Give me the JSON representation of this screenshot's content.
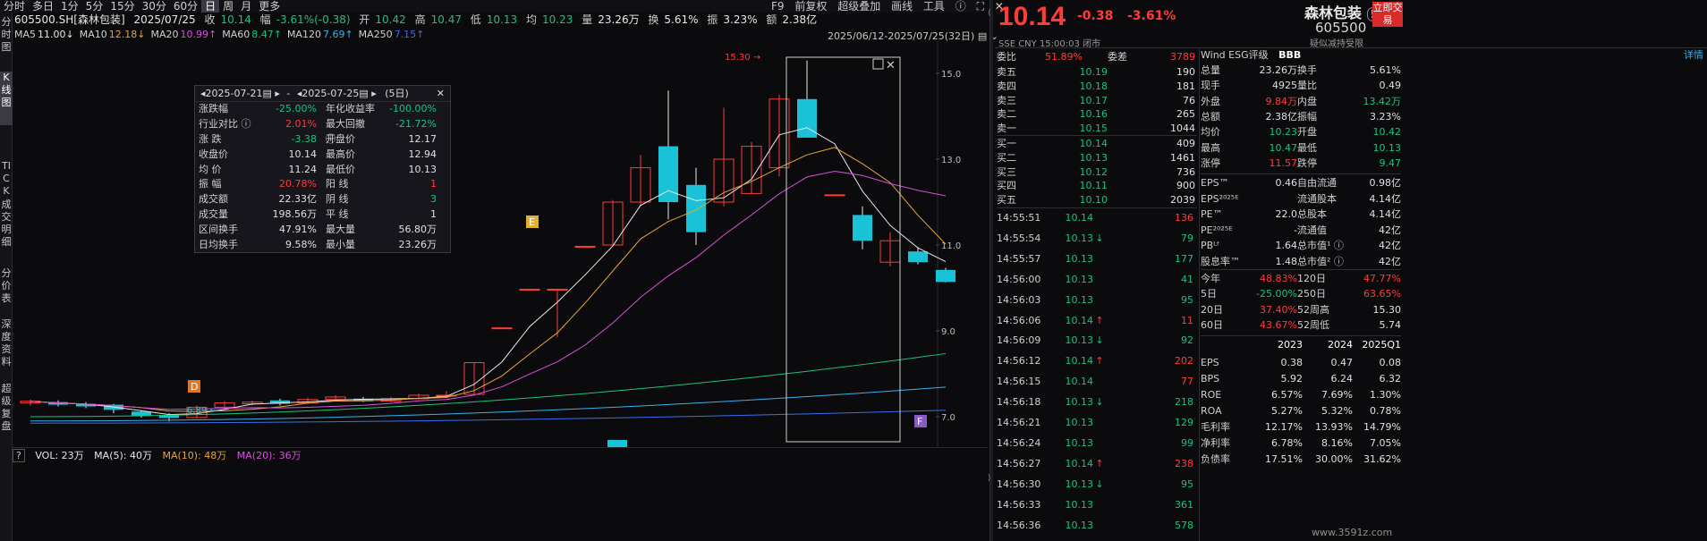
{
  "tabs": [
    "分时",
    "多日",
    "1分",
    "5分",
    "15分",
    "30分",
    "60分",
    "日",
    "周",
    "月",
    "更多"
  ],
  "active_tab": "日",
  "toolbar": {
    "f9": "F9",
    "fuquan": "前复权",
    "overlay": "超级叠加",
    "draw": "画线",
    "tools": "工具"
  },
  "leftbar": [
    {
      "label": "分时图",
      "active": false
    },
    {
      "label": "K线图",
      "active": true
    },
    {
      "label": "TICK",
      "active": false
    },
    {
      "label": "成交明细",
      "active": false
    },
    {
      "label": "分价表",
      "active": false
    },
    {
      "label": "深度资料",
      "active": false
    },
    {
      "label": "超级复盘",
      "active": false
    }
  ],
  "info": {
    "code": "605500.SH[森林包装]",
    "date": "2025/07/25",
    "close_label": "收",
    "close": "10.14",
    "chg_label": "幅",
    "chg": "-3.61%(-0.38)",
    "open_label": "开",
    "open": "10.42",
    "high_label": "高",
    "high": "10.47",
    "low_label": "低",
    "low": "10.13",
    "avg_label": "均",
    "avg": "10.23",
    "vol_label": "量",
    "vol": "23.26万",
    "turn_label": "换",
    "turn": "5.61%",
    "amp_label": "振",
    "amp": "3.23%",
    "amt_label": "额",
    "amt": "2.38亿"
  },
  "ma": [
    {
      "label": "MA5",
      "value": "11.00↓",
      "color": "#e8e8e8"
    },
    {
      "label": "MA10",
      "value": "12.18↓",
      "color": "#e8a43a"
    },
    {
      "label": "MA20",
      "value": "10.99↑",
      "color": "#d94fd9"
    },
    {
      "label": "MA60",
      "value": "8.47↑",
      "color": "#19c37d"
    },
    {
      "label": "MA120",
      "value": "7.69↑",
      "color": "#3ab0e8"
    },
    {
      "label": "MA250",
      "value": "7.15↑",
      "color": "#3a6ee8"
    }
  ],
  "range_text": "2025/06/12-2025/07/25(32日)",
  "y_axis": [
    "15.0",
    "13.0",
    "11.0",
    "9.0",
    "7.0"
  ],
  "annotations": {
    "high_label": "15.30",
    "low_label": "6.89",
    "E": "E",
    "D": "D",
    "F": "F"
  },
  "stats": {
    "date_from": "2025-07-21",
    "date_to": "2025-07-25",
    "days": "(5日)",
    "sep": "-",
    "rows": [
      [
        "涨跌幅",
        "-25.00%",
        "年化收益率",
        "-100.00%"
      ],
      [
        "行业对比 ⓘ",
        "2.01%",
        "最大回撤 ⓘ",
        "-21.72%"
      ],
      [
        "涨  跌",
        "-3.38",
        "开盘价",
        "12.17"
      ],
      [
        "收盘价",
        "10.14",
        "最高价",
        "12.94"
      ],
      [
        "均  价",
        "11.24",
        "最低价",
        "10.13"
      ],
      [
        "振  幅",
        "20.78%",
        "阳  线",
        "1"
      ],
      [
        "成交额",
        "22.33亿",
        "阴  线",
        "3"
      ],
      [
        "成交量",
        "198.56万",
        "平  线",
        "1"
      ],
      [
        "区间换手",
        "47.91%",
        "最大量",
        "56.80万"
      ],
      [
        "日均换手",
        "9.58%",
        "最小量",
        "23.26万"
      ]
    ]
  },
  "volbar": {
    "q": "?",
    "vol": "VOL: 23万",
    "ma5": "MA(5): 40万",
    "ma10": "MA(10): 48万",
    "ma20": "MA(20): 36万"
  },
  "quote": {
    "price": "10.14",
    "chg": "-0.38",
    "pct": "-3.61%",
    "name": "森林包装",
    "code": "605500",
    "buy": "立即交易",
    "sub": "SSE  CNY  15:00:03  闭市",
    "sub2": "疑似减持受限"
  },
  "order_book": {
    "wb_label": "委比",
    "wb": "51.89%",
    "wc_label": "委差",
    "wc": "3789",
    "asks": [
      [
        "卖五",
        "10.19",
        "190"
      ],
      [
        "卖四",
        "10.18",
        "181"
      ],
      [
        "卖三",
        "10.17",
        "76"
      ],
      [
        "卖二",
        "10.16",
        "265"
      ],
      [
        "卖一",
        "10.15",
        "1044"
      ]
    ],
    "bids": [
      [
        "买一",
        "10.14",
        "409"
      ],
      [
        "买二",
        "10.13",
        "1461"
      ],
      [
        "买三",
        "10.12",
        "736"
      ],
      [
        "买四",
        "10.11",
        "900"
      ],
      [
        "买五",
        "10.10",
        "2039"
      ]
    ]
  },
  "ticks": [
    [
      "14:55:51",
      "10.14",
      "",
      "136",
      "r"
    ],
    [
      "14:55:54",
      "10.13",
      "↓",
      "79",
      "g"
    ],
    [
      "14:55:57",
      "10.13",
      "",
      "177",
      "g"
    ],
    [
      "14:56:00",
      "10.13",
      "",
      "41",
      "g"
    ],
    [
      "14:56:03",
      "10.13",
      "",
      "95",
      "g"
    ],
    [
      "14:56:06",
      "10.14",
      "↑",
      "11",
      "r"
    ],
    [
      "14:56:09",
      "10.13",
      "↓",
      "92",
      "g"
    ],
    [
      "14:56:12",
      "10.14",
      "↑",
      "202",
      "r"
    ],
    [
      "14:56:15",
      "10.14",
      "",
      "77",
      "r"
    ],
    [
      "14:56:18",
      "10.13",
      "↓",
      "218",
      "g"
    ],
    [
      "14:56:21",
      "10.13",
      "",
      "129",
      "g"
    ],
    [
      "14:56:24",
      "10.13",
      "",
      "99",
      "g"
    ],
    [
      "14:56:27",
      "10.14",
      "↑",
      "238",
      "r"
    ],
    [
      "14:56:30",
      "10.13",
      "↓",
      "95",
      "g"
    ],
    [
      "14:56:33",
      "10.13",
      "",
      "361",
      "g"
    ],
    [
      "14:56:36",
      "10.13",
      "",
      "578",
      "g"
    ]
  ],
  "wind": {
    "label": "Wind ESG评级",
    "rating": "BBB",
    "detail": "详情"
  },
  "fund_rows": [
    [
      "总量",
      "23.26万",
      "w",
      "换手",
      "5.61%",
      "w"
    ],
    [
      "现手",
      "4925",
      "w",
      "量比",
      "0.49",
      "w"
    ],
    [
      "外盘",
      "9.84万",
      "r",
      "内盘",
      "13.42万",
      "g"
    ],
    [
      "总额",
      "2.38亿",
      "w",
      "振幅",
      "3.23%",
      "w"
    ],
    [
      "均价",
      "10.23",
      "g",
      "开盘",
      "10.42",
      "g"
    ],
    [
      "最高",
      "10.47",
      "g",
      "最低",
      "10.13",
      "g"
    ],
    [
      "涨停",
      "11.57",
      "r",
      "跌停",
      "9.47",
      "g"
    ]
  ],
  "fin_rows": [
    [
      "EPS™",
      "0.46",
      "自由流通",
      "0.98亿"
    ],
    [
      "EPS²⁰²⁵ᴱ",
      "",
      "流通股本",
      "4.14亿"
    ],
    [
      "PE™",
      "22.0",
      "总股本",
      "4.14亿"
    ],
    [
      "PE²⁰²⁵ᴱ",
      "-",
      "流通值",
      "42亿"
    ],
    [
      "PBᴸᶠ",
      "1.64",
      "总市值¹ ⓘ",
      "42亿"
    ],
    [
      "股息率™",
      "1.48",
      "总市值² ⓘ",
      "42亿"
    ]
  ],
  "perf_rows": [
    [
      "今年",
      "48.83%",
      "r",
      "120日",
      "47.77%",
      "r"
    ],
    [
      "5日",
      "-25.00%",
      "g",
      "250日",
      "63.65%",
      "r"
    ],
    [
      "20日",
      "37.40%",
      "r",
      "52周高",
      "15.30",
      "w"
    ],
    [
      "60日",
      "43.67%",
      "r",
      "52周低",
      "5.74",
      "w"
    ]
  ],
  "annual": {
    "years": [
      "2023",
      "2024",
      "2025Q1"
    ],
    "rows": [
      [
        "EPS",
        "0.38",
        "0.47",
        "0.08"
      ],
      [
        "BPS",
        "5.92",
        "6.24",
        "6.32"
      ],
      [
        "ROE",
        "6.57%",
        "7.69%",
        "1.30%"
      ],
      [
        "ROA",
        "5.27%",
        "5.32%",
        "0.78%"
      ],
      [
        "毛利率",
        "12.17%",
        "13.93%",
        "14.79%"
      ],
      [
        "净利率",
        "6.78%",
        "8.16%",
        "7.05%"
      ],
      [
        "负债率",
        "17.51%",
        "30.00%",
        "31.62%"
      ]
    ]
  },
  "watermark": "www.3591z.com",
  "colors": {
    "up": "#ff3b3b",
    "down": "#19c2d6",
    "bg": "#0b0b0e",
    "ma5": "#e8e8e8",
    "ma10": "#e8a43a",
    "ma20": "#d94fd9",
    "ma60": "#19c37d",
    "ma120": "#3ab0e8",
    "ma250": "#3a6ee8"
  },
  "chart_data": {
    "type": "candlestick",
    "y_range": [
      6.5,
      16
    ],
    "candles": [
      {
        "o": 7.32,
        "c": 7.36,
        "h": 7.4,
        "l": 7.26
      },
      {
        "o": 7.34,
        "c": 7.28,
        "h": 7.38,
        "l": 7.24
      },
      {
        "o": 7.3,
        "c": 7.24,
        "h": 7.34,
        "l": 7.2
      },
      {
        "o": 7.28,
        "c": 7.16,
        "h": 7.3,
        "l": 7.08
      },
      {
        "o": 7.12,
        "c": 7.02,
        "h": 7.14,
        "l": 6.98
      },
      {
        "o": 7.04,
        "c": 6.97,
        "h": 7.08,
        "l": 6.89
      },
      {
        "o": 6.98,
        "c": 7.22,
        "h": 7.26,
        "l": 6.96
      },
      {
        "o": 7.22,
        "c": 7.32,
        "h": 7.36,
        "l": 7.18
      },
      {
        "o": 7.3,
        "c": 7.34,
        "h": 7.38,
        "l": 7.26
      },
      {
        "o": 7.38,
        "c": 7.3,
        "h": 7.42,
        "l": 7.26
      },
      {
        "o": 7.32,
        "c": 7.4,
        "h": 7.44,
        "l": 7.3
      },
      {
        "o": 7.4,
        "c": 7.46,
        "h": 7.5,
        "l": 7.36
      },
      {
        "o": 7.42,
        "c": 7.36,
        "h": 7.46,
        "l": 7.34
      },
      {
        "o": 7.36,
        "c": 7.42,
        "h": 7.46,
        "l": 7.34
      },
      {
        "o": 7.42,
        "c": 7.5,
        "h": 7.54,
        "l": 7.4
      },
      {
        "o": 7.48,
        "c": 7.5,
        "h": 7.6,
        "l": 7.44
      },
      {
        "o": 7.52,
        "c": 8.26,
        "h": 8.26,
        "l": 7.52
      },
      {
        "o": 9.07,
        "c": 9.07,
        "h": 9.07,
        "l": 9.07
      },
      {
        "o": 9.97,
        "c": 9.97,
        "h": 9.97,
        "l": 9.97
      },
      {
        "o": 9.97,
        "c": 9.97,
        "h": 9.97,
        "l": 8.86
      },
      {
        "o": 10.97,
        "c": 10.97,
        "h": 10.97,
        "l": 10.97
      },
      {
        "o": 11.0,
        "c": 12.0,
        "h": 12.05,
        "l": 10.97
      },
      {
        "o": 12.0,
        "c": 12.8,
        "h": 13.1,
        "l": 11.9
      },
      {
        "o": 13.3,
        "c": 12.0,
        "h": 14.6,
        "l": 11.6
      },
      {
        "o": 12.4,
        "c": 11.3,
        "h": 12.8,
        "l": 11.0
      },
      {
        "o": 12.0,
        "c": 13.0,
        "h": 14.2,
        "l": 11.9
      },
      {
        "o": 12.2,
        "c": 13.3,
        "h": 13.4,
        "l": 12.2
      },
      {
        "o": 12.8,
        "c": 14.4,
        "h": 14.5,
        "l": 12.6
      },
      {
        "o": 14.4,
        "c": 13.5,
        "h": 15.3,
        "l": 13.5
      },
      {
        "o": 12.17,
        "c": 12.17,
        "h": 12.17,
        "l": 12.17
      },
      {
        "o": 11.7,
        "c": 11.1,
        "h": 11.9,
        "l": 10.9
      },
      {
        "o": 10.6,
        "c": 11.1,
        "h": 11.3,
        "l": 10.5
      },
      {
        "o": 10.85,
        "c": 10.6,
        "h": 10.95,
        "l": 10.55
      },
      {
        "o": 10.42,
        "c": 10.14,
        "h": 10.47,
        "l": 10.13
      }
    ]
  }
}
